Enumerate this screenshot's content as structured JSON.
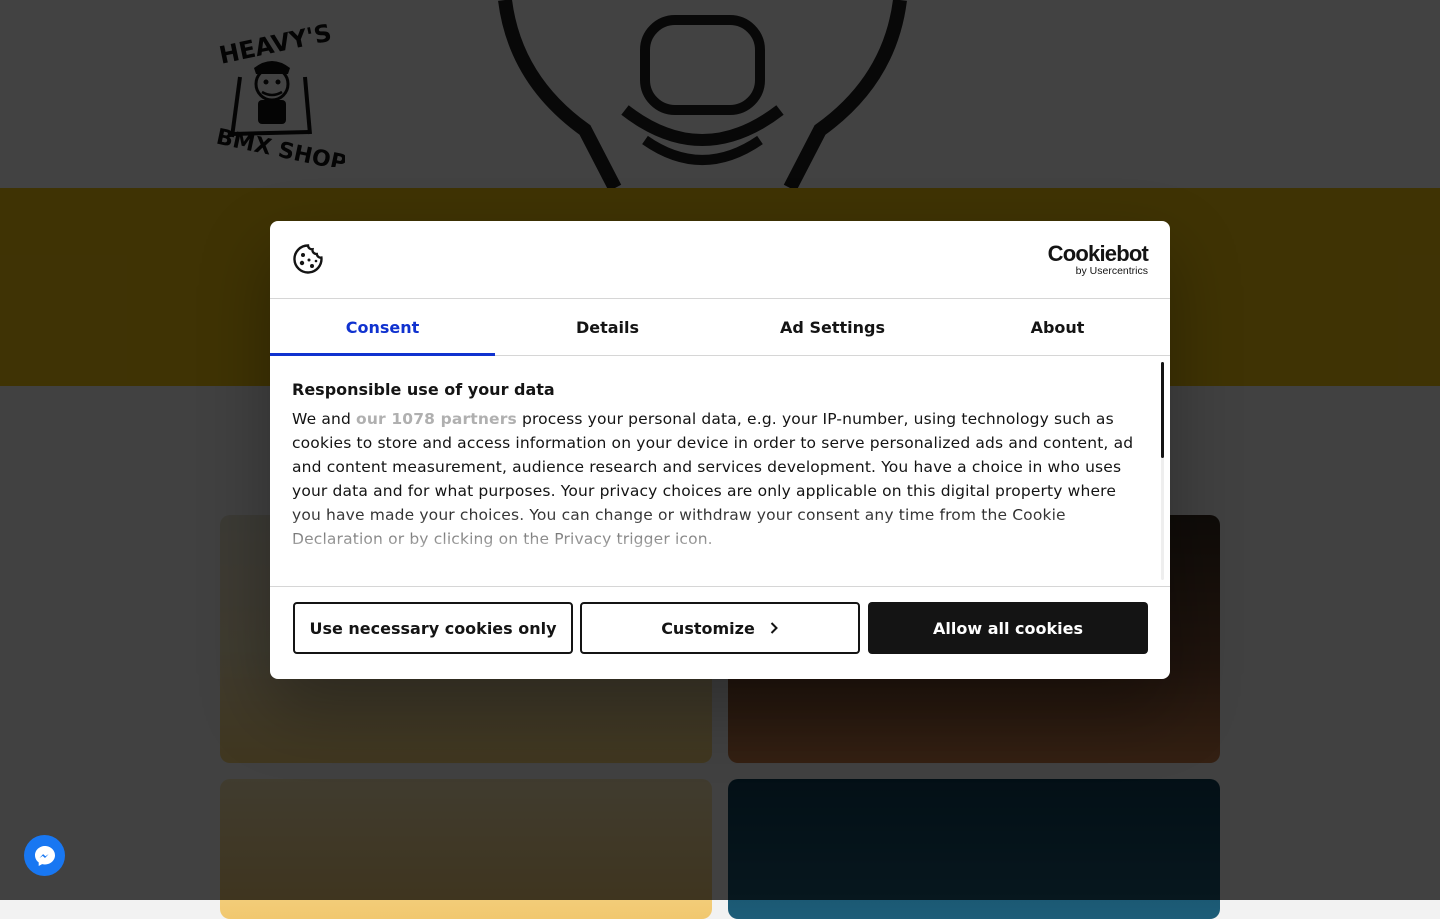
{
  "background": {
    "logo_alt": "HEAVY'S BMX SHOP",
    "band_color": "#f3c512"
  },
  "dialog": {
    "brand": {
      "name": "Cookiebot",
      "sub": "by Usercentrics"
    },
    "tabs": [
      {
        "label": "Consent",
        "active": true
      },
      {
        "label": "Details",
        "active": false
      },
      {
        "label": "Ad Settings",
        "active": false
      },
      {
        "label": "About",
        "active": false
      }
    ],
    "heading": "Responsible use of your data",
    "text_before": "We and ",
    "partners_link": "our 1078 partners",
    "text_after": " process your personal data, e.g. your IP-number, using technology such as cookies to store and access information on your device in order to serve personalized ads and content, ad and content measurement, audience research and services development. You have a choice in who uses your data and for what purposes. Your privacy choices are only applicable on this digital property where you have made your choices. You can change or withdraw your consent any time from the Cookie Declaration or by clicking on the Privacy trigger icon.",
    "buttons": {
      "necessary": "Use necessary cookies only",
      "customize": "Customize",
      "allow": "Allow all cookies"
    }
  },
  "colors": {
    "accent": "#1032cf",
    "text": "#141414",
    "messenger": "#1877f2"
  }
}
